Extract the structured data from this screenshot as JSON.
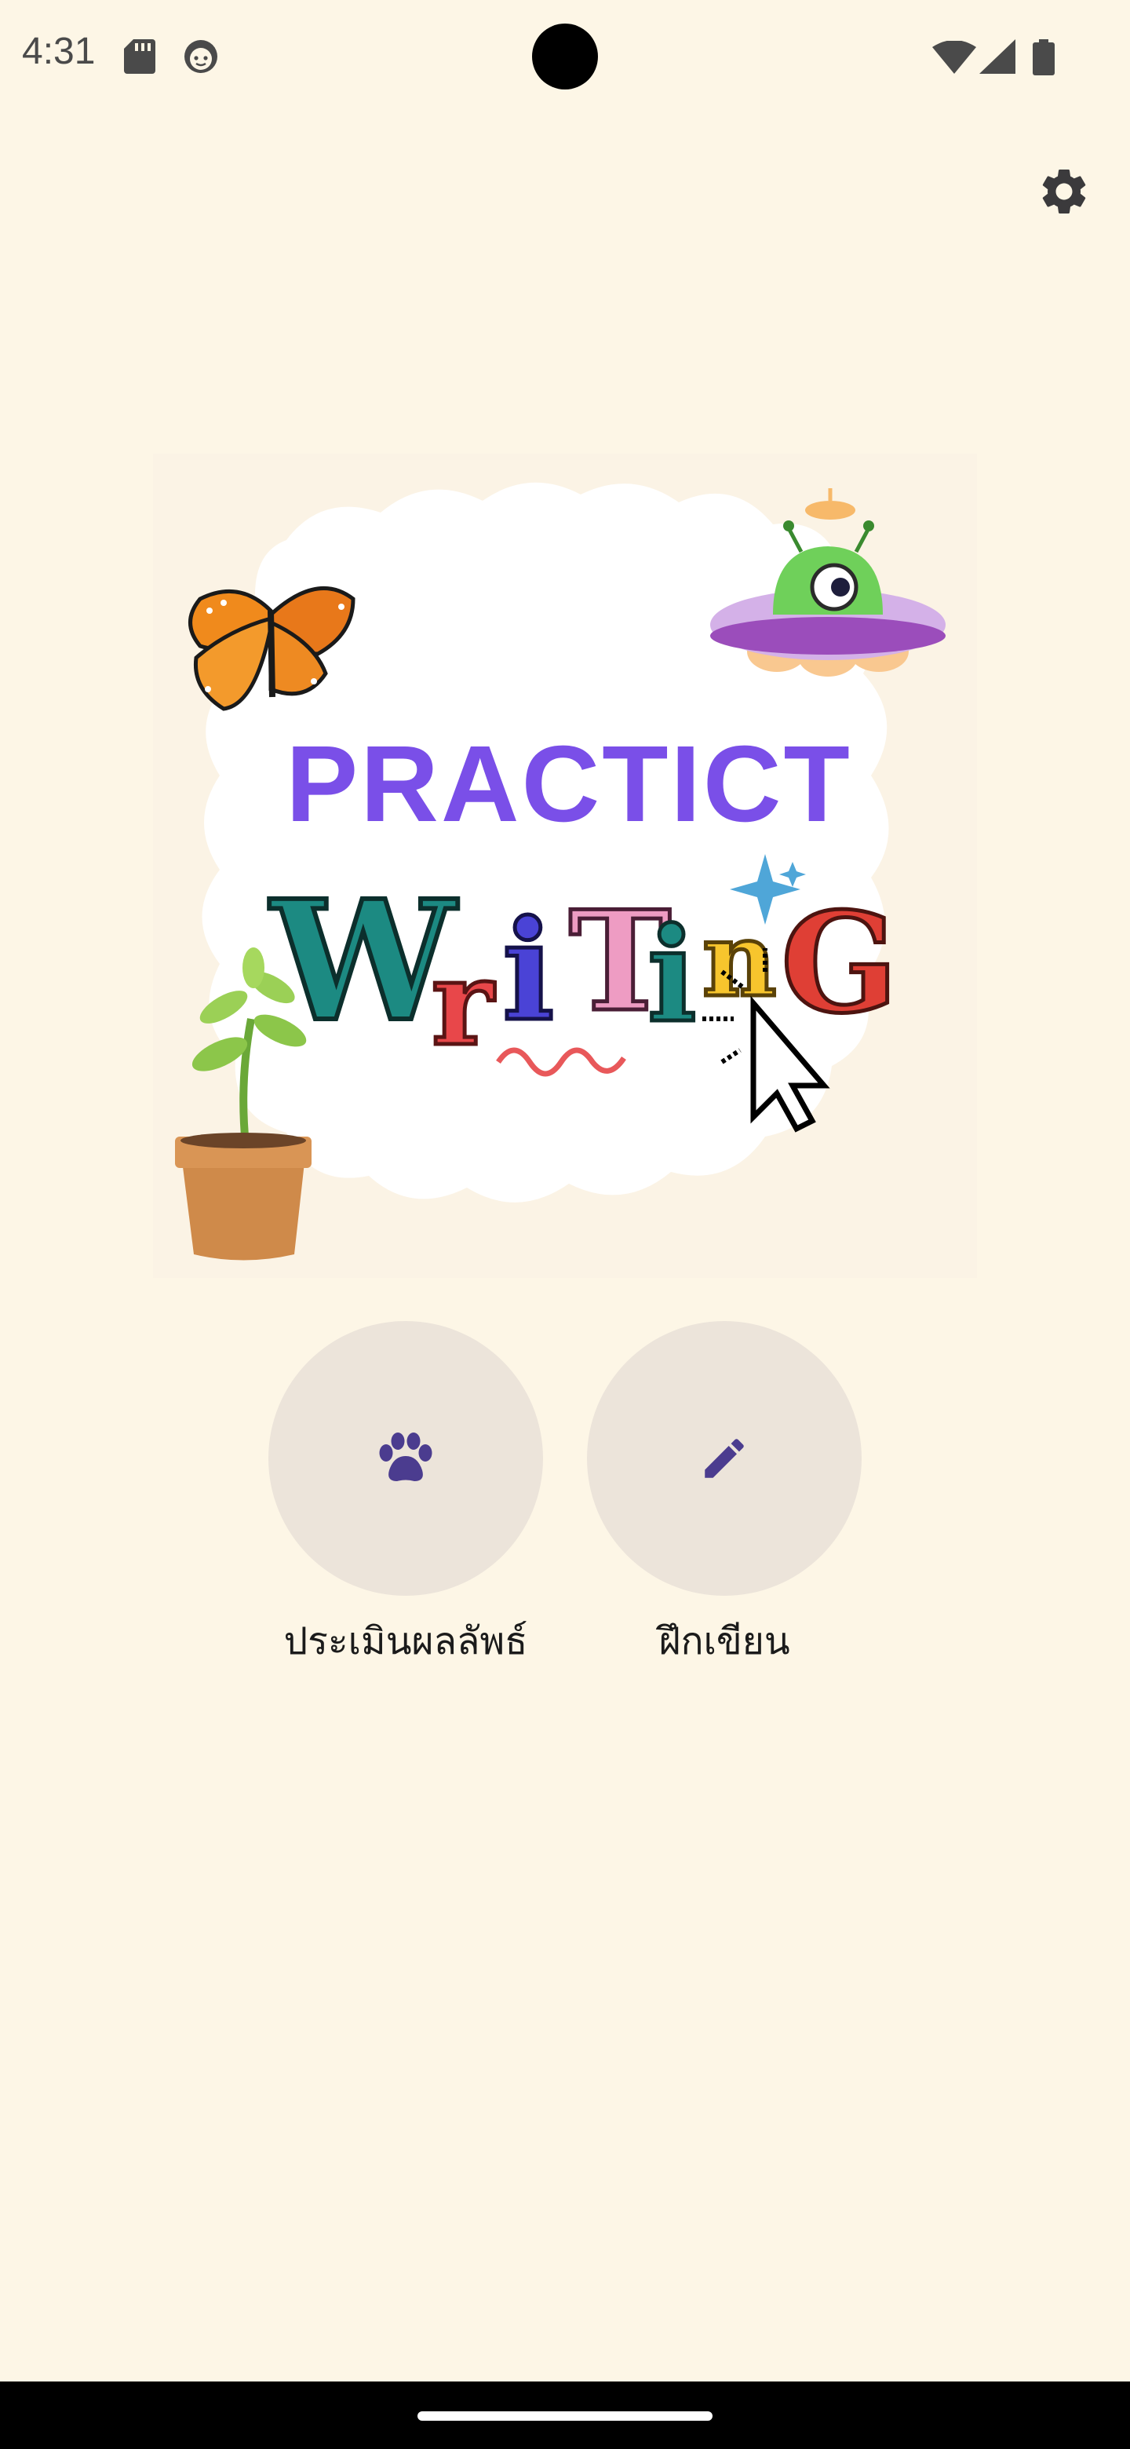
{
  "status_bar": {
    "time": "4:31",
    "icons": [
      "sd-card-icon",
      "face-icon",
      "wifi-icon",
      "signal-icon",
      "battery-icon"
    ]
  },
  "header": {
    "settings_icon": "gear-icon"
  },
  "hero": {
    "title_line1": "PRACTICT",
    "title_line2": "WriTinG"
  },
  "actions": [
    {
      "label": "ประเมินผลลัพธ์",
      "icon": "paw-icon"
    },
    {
      "label": "ฝึกเขียน",
      "icon": "pencil-icon"
    }
  ],
  "colors": {
    "background": "#fdf6e6",
    "button_circle": "#ece4da",
    "icon_accent": "#4b3c8f",
    "gear": "#3b3a3c"
  }
}
